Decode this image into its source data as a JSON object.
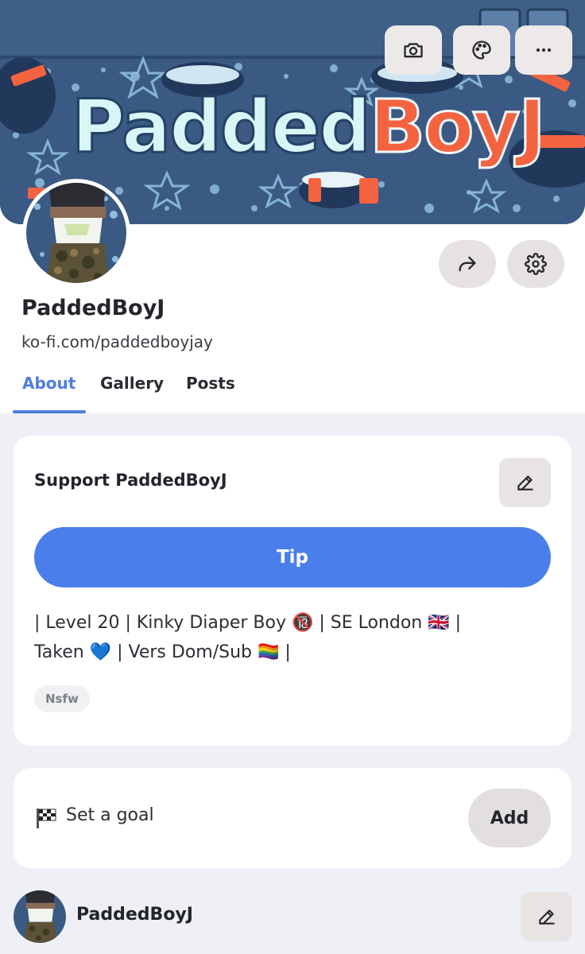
{
  "banner": {
    "title_part1": "Padded",
    "title_part2": "BoyJ"
  },
  "toolbar": {
    "camera_icon": "camera-icon",
    "palette_icon": "palette-icon",
    "more_icon": "more-horizontal-icon"
  },
  "profile": {
    "name": "PaddedBoyJ",
    "url": "ko-fi.com/paddedboyjay",
    "share_icon": "share-arrow-icon",
    "settings_icon": "gear-icon"
  },
  "tabs": [
    {
      "label": "About",
      "active": true
    },
    {
      "label": "Gallery",
      "active": false
    },
    {
      "label": "Posts",
      "active": false
    }
  ],
  "support": {
    "title": "Support PaddedBoyJ",
    "edit_icon": "edit-pencil-icon",
    "tip_label": "Tip",
    "bio_line1": "| Level 20 | Kinky Diaper Boy 🔞 | SE London 🇬🇧 |",
    "bio_line2": "Taken 💙 | Vers Dom/Sub 🏳️‍🌈 |",
    "tag": "Nsfw"
  },
  "goal": {
    "label": "Set a goal",
    "flag_icon": "checkered-flag-icon",
    "add_label": "Add"
  },
  "footer": {
    "name": "PaddedBoyJ",
    "edit_icon": "edit-pencil-icon"
  },
  "colors": {
    "accent": "#4a7eea",
    "banner_bg": "#3a5a83",
    "banner_orange": "#f4633f",
    "banner_letters": "#d9f6f7",
    "button_gray": "#e8e4e3",
    "page_bg": "#eef0f5"
  }
}
